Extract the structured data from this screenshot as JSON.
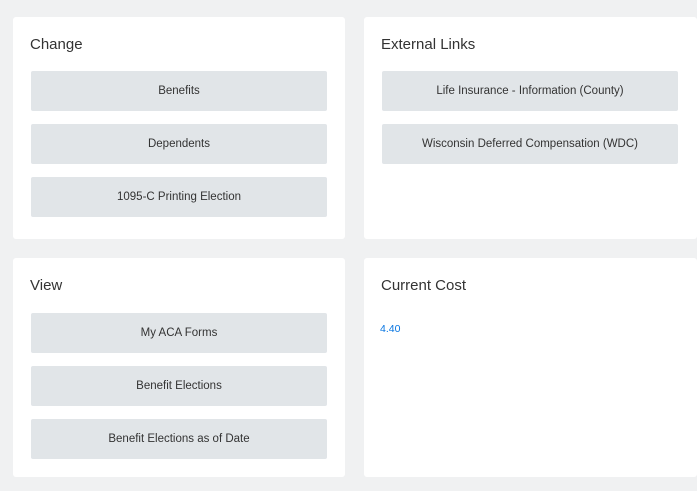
{
  "cards": {
    "change": {
      "title": "Change",
      "buttons": [
        "Benefits",
        "Dependents",
        "1095-C Printing Election"
      ]
    },
    "external_links": {
      "title": "External Links",
      "buttons": [
        "Life Insurance - Information (County)",
        "Wisconsin Deferred Compensation (WDC)"
      ]
    },
    "view": {
      "title": "View",
      "buttons": [
        "My ACA Forms",
        "Benefit Elections",
        "Benefit Elections as of Date"
      ]
    },
    "current_cost": {
      "title": "Current Cost",
      "value": "4.40"
    }
  },
  "colors": {
    "page_bg": "#f0f1f2",
    "card_bg": "#ffffff",
    "button_bg": "#e1e5e8",
    "link": "#0875e1"
  }
}
